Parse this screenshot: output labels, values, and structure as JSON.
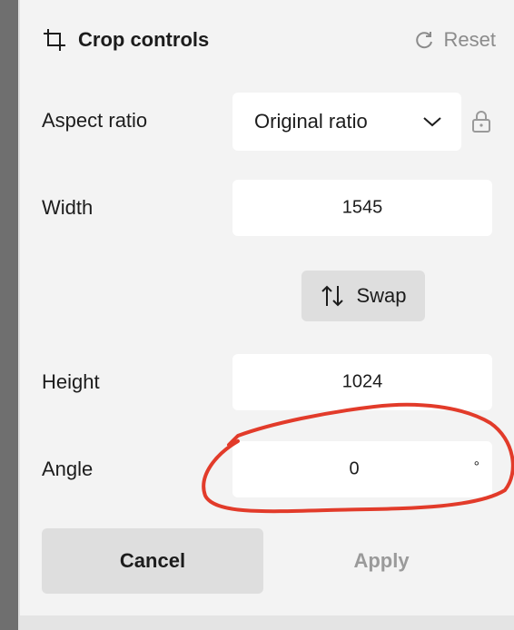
{
  "header": {
    "title": "Crop controls",
    "reset_label": "Reset",
    "crop_icon": "crop-icon",
    "reset_icon": "refresh-icon"
  },
  "aspect_ratio": {
    "label": "Aspect ratio",
    "selected": "Original ratio",
    "chevron_icon": "chevron-down-icon",
    "lock_icon": "lock-icon"
  },
  "width": {
    "label": "Width",
    "value": "1545"
  },
  "swap": {
    "label": "Swap",
    "icon": "swap-arrows-icon"
  },
  "height": {
    "label": "Height",
    "value": "1024"
  },
  "angle": {
    "label": "Angle",
    "value": "0",
    "unit": "°"
  },
  "footer": {
    "cancel_label": "Cancel",
    "apply_label": "Apply"
  },
  "colors": {
    "panel_background": "#f3f3f3",
    "field_background": "#ffffff",
    "button_background": "#dedede",
    "muted_text": "#8b8b8b",
    "annotation_red": "#e23b2a"
  }
}
